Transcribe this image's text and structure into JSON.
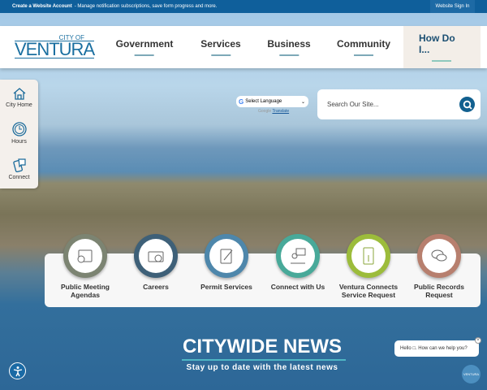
{
  "topbar": {
    "account_link": "Create a Website Account",
    "account_desc": "- Manage notification subscriptions, save form progress and more.",
    "sign_in": "Website Sign In"
  },
  "logo": {
    "city_of": "CITY OF",
    "name": "VENTURA"
  },
  "nav": [
    "Government",
    "Services",
    "Business",
    "Community",
    "How Do I..."
  ],
  "sidebar": [
    "City Home",
    "Hours",
    "Connect"
  ],
  "translate": {
    "select": "Select Language",
    "powered": "Google",
    "link": "Translate"
  },
  "search": {
    "placeholder": "Search Our Site..."
  },
  "quick_links": [
    {
      "label": "Public Meeting Agendas",
      "color": "#7c8472"
    },
    {
      "label": "Careers",
      "color": "#3e6078"
    },
    {
      "label": "Permit Services",
      "color": "#4e87ab"
    },
    {
      "label": "Connect with Us",
      "color": "#48a999"
    },
    {
      "label": "Ventura Connects Service Request",
      "color": "#9cbc3b"
    },
    {
      "label": "Public Records Request",
      "color": "#b77f6e"
    }
  ],
  "news": {
    "title": "CITYWIDE NEWS",
    "subtitle": "Stay up to date with the latest news"
  },
  "chat": {
    "greeting": "Hello □. How can we help you?",
    "close": "×"
  },
  "badge": "VENTURA"
}
